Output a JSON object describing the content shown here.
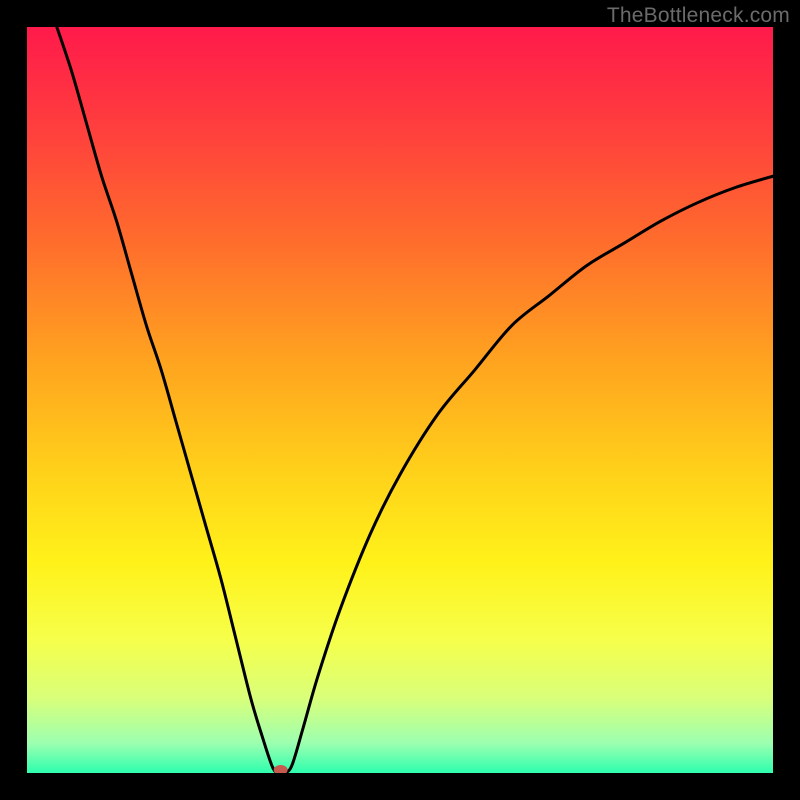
{
  "watermark": "TheBottleneck.com",
  "chart_data": {
    "type": "line",
    "title": "",
    "xlabel": "",
    "ylabel": "",
    "xlim": [
      0,
      100
    ],
    "ylim": [
      0,
      100
    ],
    "grid": false,
    "legend": false,
    "background_gradient_stops": [
      {
        "pos": 0.0,
        "color": "#ff1a4b"
      },
      {
        "pos": 0.12,
        "color": "#ff3a3f"
      },
      {
        "pos": 0.28,
        "color": "#ff6a2d"
      },
      {
        "pos": 0.45,
        "color": "#ffa41f"
      },
      {
        "pos": 0.6,
        "color": "#ffd21a"
      },
      {
        "pos": 0.72,
        "color": "#fff21a"
      },
      {
        "pos": 0.82,
        "color": "#f6ff4a"
      },
      {
        "pos": 0.9,
        "color": "#d9ff7a"
      },
      {
        "pos": 0.96,
        "color": "#9cffb0"
      },
      {
        "pos": 1.0,
        "color": "#2dffae"
      }
    ],
    "series": [
      {
        "name": "curve",
        "x": [
          4,
          6,
          8,
          10,
          12,
          14,
          16,
          18,
          20,
          22,
          24,
          26,
          28,
          30,
          31.5,
          33,
          34,
          34.5,
          35.5,
          37,
          39,
          42,
          46,
          50,
          55,
          60,
          65,
          70,
          75,
          80,
          85,
          90,
          95,
          100
        ],
        "y": [
          100,
          94,
          87,
          80,
          74,
          67,
          60,
          54,
          47,
          40,
          33,
          26,
          18,
          10,
          5,
          0.6,
          0,
          0,
          1,
          6,
          13,
          22,
          32,
          40,
          48,
          54,
          60,
          64,
          68,
          71,
          74,
          76.5,
          78.5,
          80
        ]
      }
    ],
    "marker": {
      "name": "minimum-marker",
      "x": 34,
      "y": 0,
      "color": "#c75a4e",
      "rx": 7,
      "ry": 5
    }
  }
}
